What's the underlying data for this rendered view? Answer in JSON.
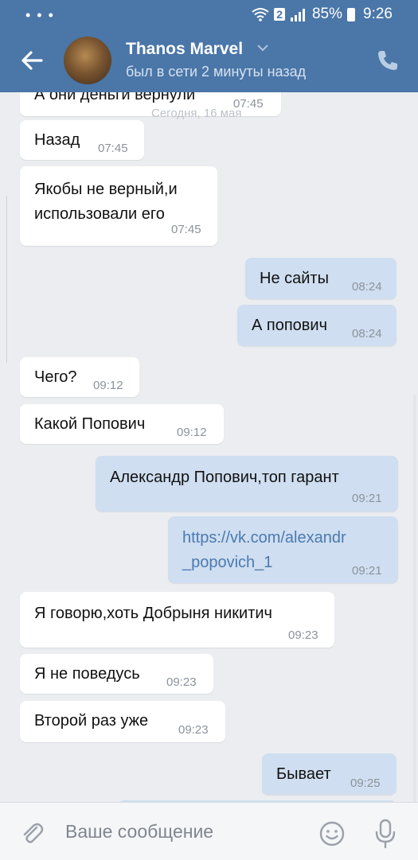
{
  "statusbar": {
    "left_icons": "•••",
    "sim": "2",
    "battery": "85%",
    "time": "9:26"
  },
  "header": {
    "contact_name": "Thanos Marvel",
    "contact_status": "был в сети 2 минуты назад"
  },
  "chat": {
    "date_separator": "Сегодня, 16 мая",
    "messages": [
      {
        "dir": "in",
        "text": "А они деньги вернули",
        "time": "07:45"
      },
      {
        "dir": "in",
        "text": "Назад",
        "time": "07:45"
      },
      {
        "dir": "in",
        "text": "Якобы не верный,и\nиспользовали его",
        "time": "07:45"
      },
      {
        "dir": "out",
        "text": "Не сайты",
        "time": "08:24"
      },
      {
        "dir": "out",
        "text": "А попович",
        "time": "08:24"
      },
      {
        "dir": "in",
        "text": "Чего?",
        "time": "09:12"
      },
      {
        "dir": "in",
        "text": "Какой Попович",
        "time": "09:12"
      },
      {
        "dir": "out",
        "text": "Александр Попович,топ гарант",
        "time": "09:21"
      },
      {
        "dir": "out",
        "text": "https://vk.com/alexandr\n_popovich_1",
        "time": "09:21"
      },
      {
        "dir": "in",
        "text": "Я говорю,хоть Добрыня никитич",
        "time": "09:23"
      },
      {
        "dir": "in",
        "text": "Я не поведусь",
        "time": "09:23"
      },
      {
        "dir": "in",
        "text": "Второй раз уже",
        "time": "09:23"
      },
      {
        "dir": "out",
        "text": "Бывает",
        "time": "09:25"
      }
    ]
  },
  "input": {
    "placeholder": "Ваше сообщение"
  },
  "colors": {
    "header": "#4a76a8",
    "background": "#ebedf1",
    "incoming_bubble": "#ffffff",
    "outgoing_bubble": "#cfdef0",
    "link": "#4b7ab0"
  },
  "icons": [
    "back-arrow-icon",
    "phone-icon",
    "attach-icon",
    "emoji-icon",
    "microphone-icon",
    "wifi-icon",
    "signal-icon",
    "battery-icon"
  ]
}
